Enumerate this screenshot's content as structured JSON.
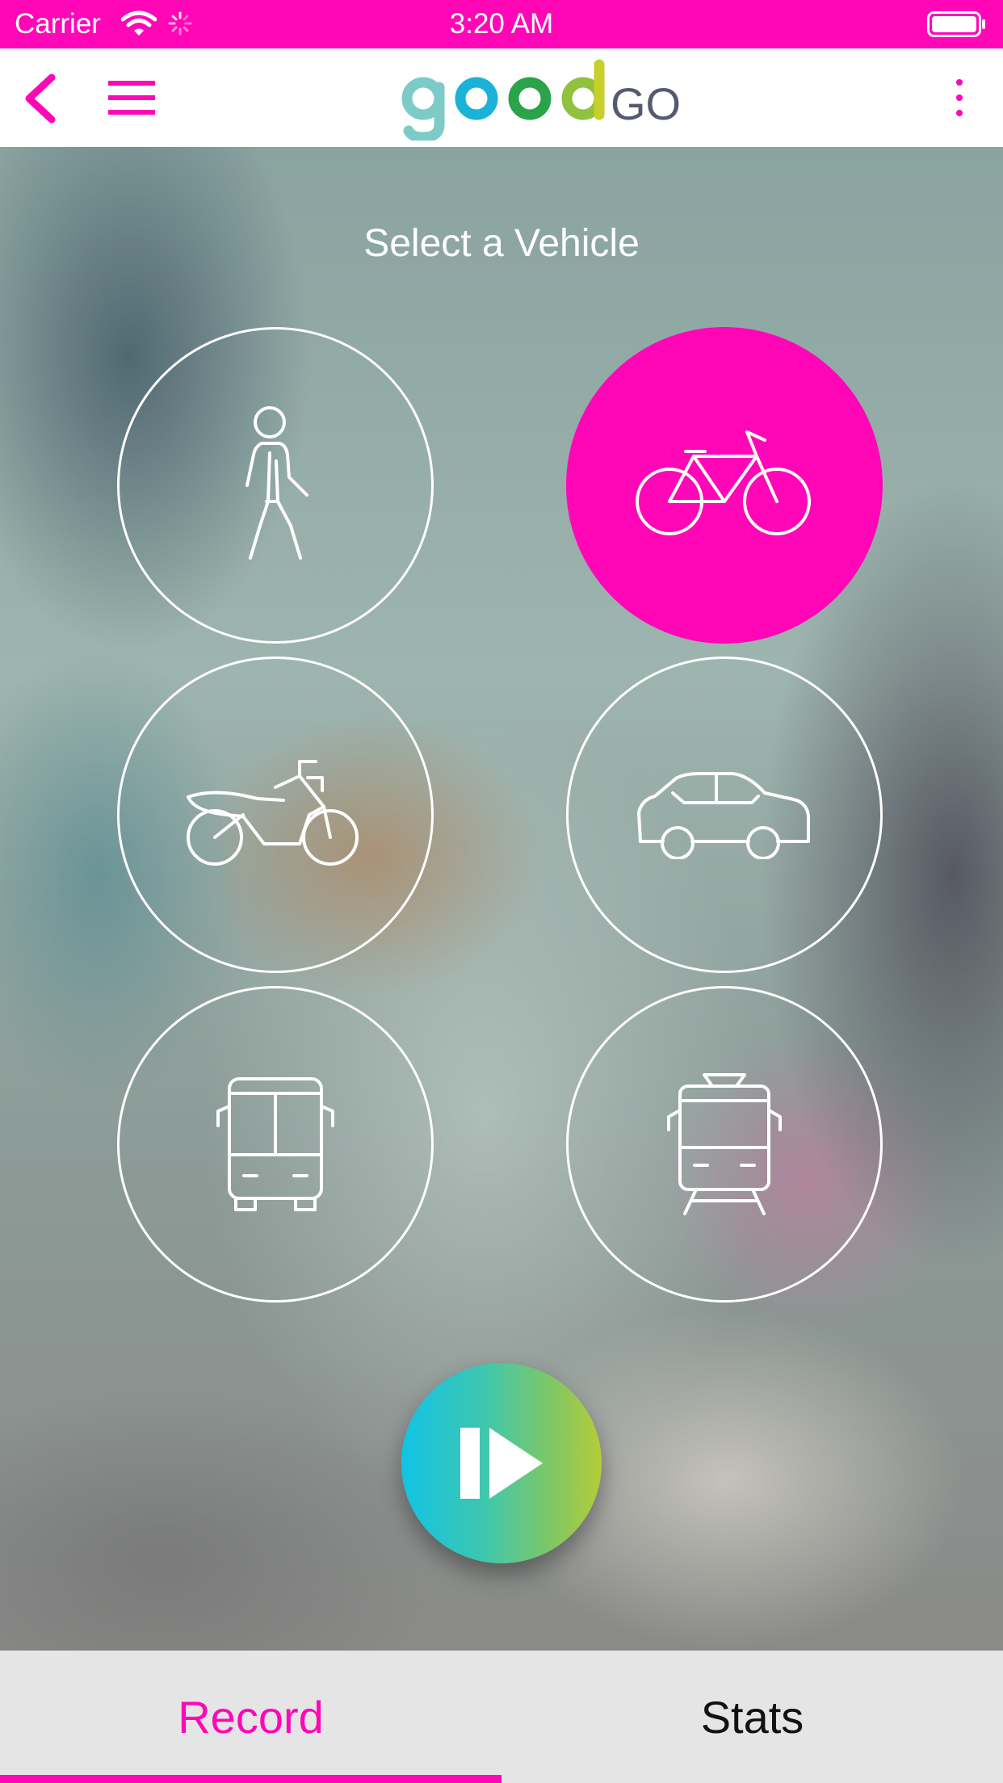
{
  "status_bar": {
    "carrier": "Carrier",
    "time": "3:20 AM",
    "background": "#ff06b7"
  },
  "nav": {
    "logo_text": "good",
    "logo_suffix": "GO",
    "icons": [
      "back-icon",
      "menu-icon",
      "more-icon"
    ]
  },
  "main": {
    "title": "Select a Vehicle",
    "vehicles": [
      {
        "name": "walk",
        "icon": "walking-person-icon",
        "selected": false
      },
      {
        "name": "bicycle",
        "icon": "bicycle-icon",
        "selected": true
      },
      {
        "name": "motorcycle",
        "icon": "motorcycle-icon",
        "selected": false
      },
      {
        "name": "car",
        "icon": "car-icon",
        "selected": false
      },
      {
        "name": "bus",
        "icon": "bus-icon",
        "selected": false
      },
      {
        "name": "tram",
        "icon": "tram-icon",
        "selected": false
      }
    ],
    "accent_color": "#ff06b7",
    "play_icon": "play-pause-icon"
  },
  "tabs": [
    {
      "label": "Record",
      "active": true
    },
    {
      "label": "Stats",
      "active": false
    }
  ]
}
